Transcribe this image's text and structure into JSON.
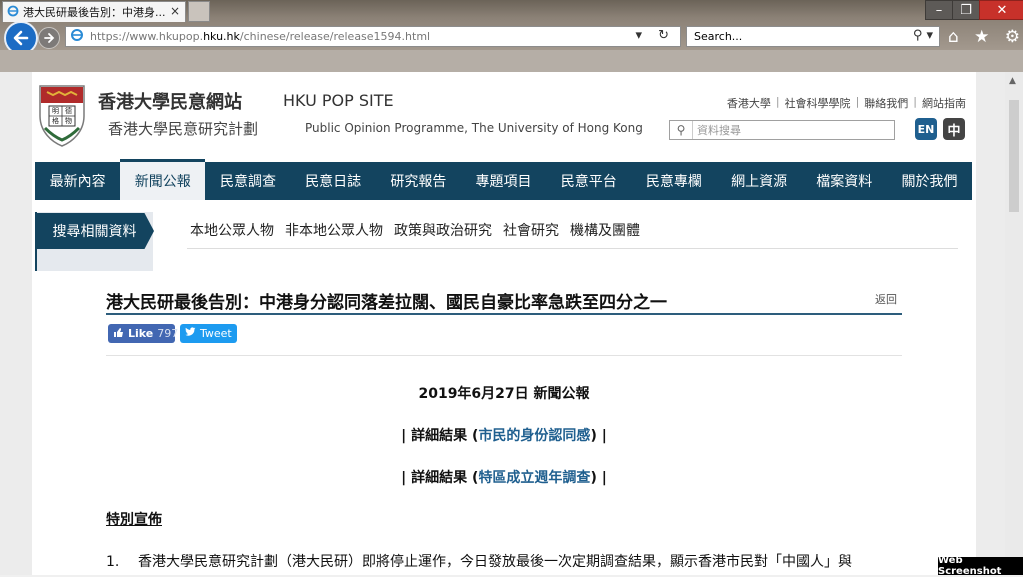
{
  "browser": {
    "url_prefix": "https://www.hkupop.",
    "url_domain": "hku.hk",
    "url_path": "/chinese/release/release1594.html",
    "search_placeholder": "Search...",
    "tab_title": "港大民研最後告別：中港身...",
    "tab_close": "×"
  },
  "site": {
    "title_zh": "香港大學民意網站",
    "title_en": "HKU POP SITE",
    "programme_zh": "香港大學民意研究計劃",
    "programme_en": "Public Opinion Programme, The University of Hong Kong",
    "top_links": [
      "香港大學",
      "社會科學學院",
      "聯絡我們",
      "網站指南"
    ],
    "search_placeholder": "資料搜尋",
    "lang_en": "EN",
    "lang_zh": "中",
    "logo_text": [
      "明",
      "德",
      "格",
      "物"
    ]
  },
  "nav": {
    "items": [
      "最新內容",
      "新聞公報",
      "民意調查",
      "民意日誌",
      "研究報告",
      "專題項目",
      "民意平台",
      "民意專欄",
      "網上資源",
      "檔案資料",
      "關於我們"
    ],
    "active_index": 1
  },
  "subnav": {
    "label": "搜尋相關資料",
    "links": [
      "本地公眾人物",
      "非本地公眾人物",
      "政策與政治研究",
      "社會研究",
      "機構及團體"
    ]
  },
  "article": {
    "title": "港大民研最後告別：中港身分認同落差拉闊、國民自豪比率急跌至四分之一",
    "back": "返回",
    "fb_label": "Like",
    "fb_count": "797",
    "tw_label": "Tweet",
    "date": "2019年6月27日 新聞公報",
    "detail1_prefix": "| 詳細結果 (",
    "detail1_link": "市民的身份認同感",
    "detail1_suffix": ") |",
    "detail2_prefix": "| 詳細結果 (",
    "detail2_link": "特區成立週年調查",
    "detail2_suffix": ") |",
    "special_heading": "特別宣佈",
    "para1_num": "1.",
    "para1_text": "香港大學民意研究計劃（港大民研）即將停止運作，今日發放最後一次定期調查結果，顯示香港市民對「中國人」與"
  },
  "watermark": "Web Screenshot"
}
